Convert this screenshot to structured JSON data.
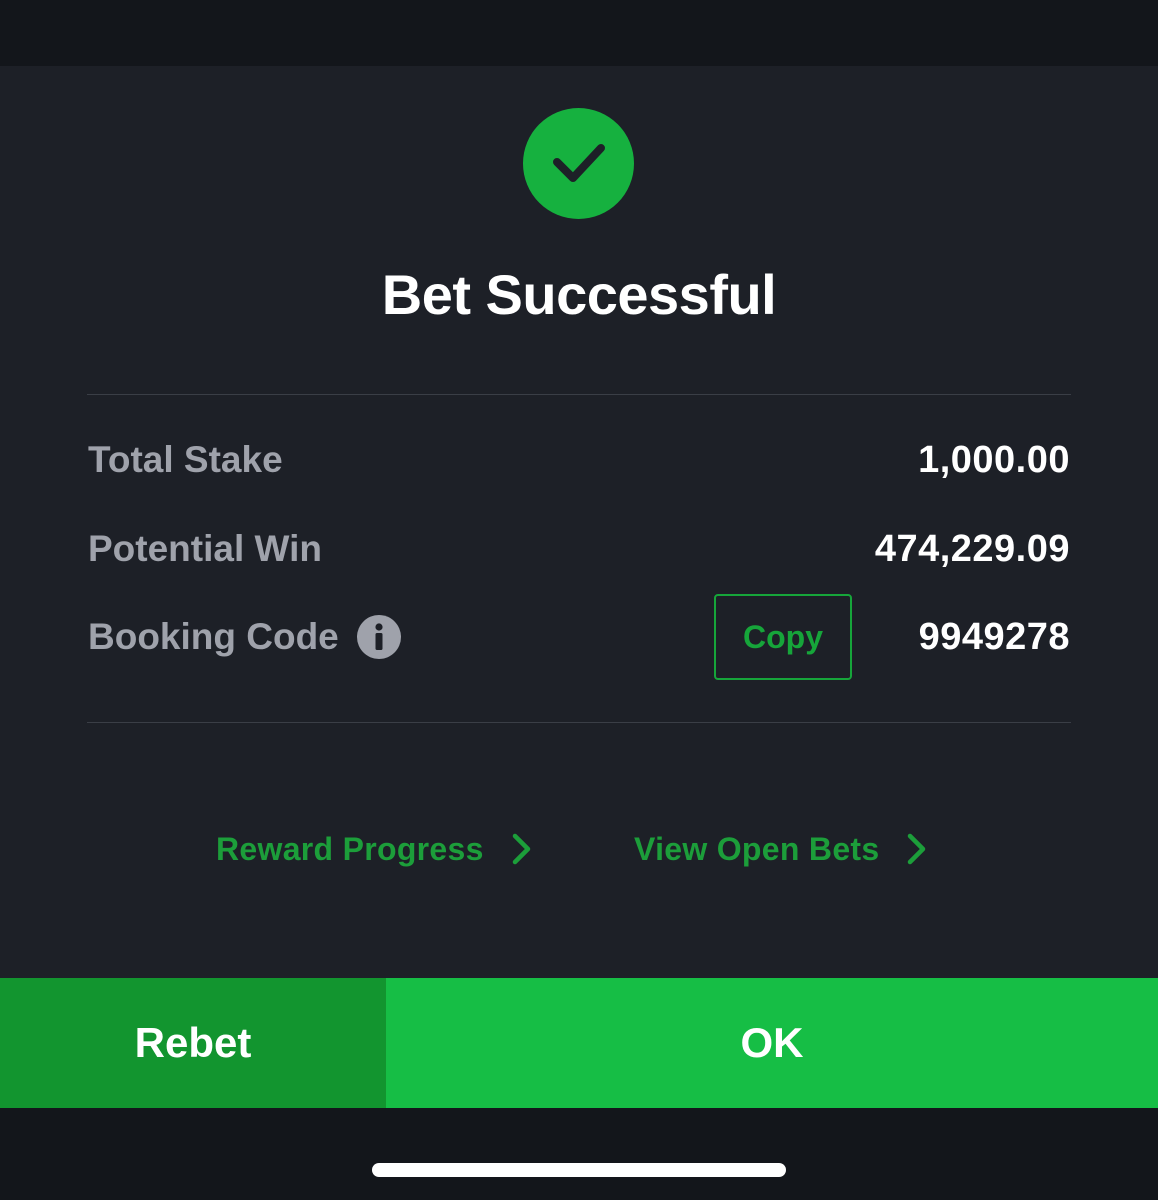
{
  "dialog": {
    "title": "Bet Successful",
    "success_icon": "check-circle-icon"
  },
  "summary": {
    "total_stake_label": "Total Stake",
    "total_stake_value": "1,000.00",
    "potential_win_label": "Potential Win",
    "potential_win_value": "474,229.09",
    "booking_code_label": "Booking Code",
    "booking_code_info_icon": "info-icon",
    "copy_label": "Copy",
    "booking_code_value": "9949278"
  },
  "links": {
    "reward_progress": "Reward Progress",
    "view_open_bets": "View Open Bets"
  },
  "actions": {
    "rebet": "Rebet",
    "ok": "OK"
  },
  "colors": {
    "accent_green": "#16be45",
    "rebet_green": "#12952f",
    "link_green": "#1c9e3a",
    "background": "#1d2027"
  }
}
